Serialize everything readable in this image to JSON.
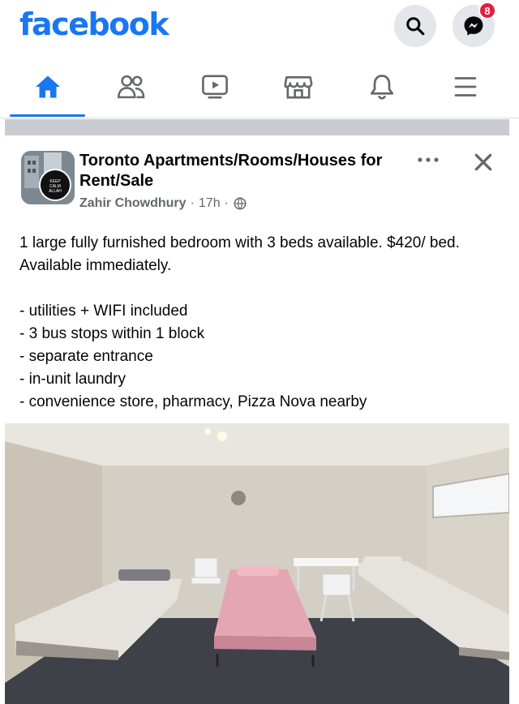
{
  "header": {
    "logo": "facebook",
    "search_icon": "search-icon",
    "messenger_icon": "messenger-icon",
    "messenger_badge": "8",
    "brand_color": "#1877f2"
  },
  "nav": {
    "items": [
      {
        "icon": "home-icon",
        "active": true
      },
      {
        "icon": "friends-icon",
        "active": false
      },
      {
        "icon": "watch-icon",
        "active": false
      },
      {
        "icon": "marketplace-icon",
        "active": false
      },
      {
        "icon": "notifications-icon",
        "active": false
      },
      {
        "icon": "menu-icon",
        "active": false
      }
    ]
  },
  "post": {
    "group_name": "Toronto Apartments/Rooms/Houses for Rent/Sale",
    "author": "Zahir Chowdhury",
    "time": "17h",
    "separator": "·",
    "privacy_icon": "globe-icon",
    "more_icon": "more-icon",
    "close_icon": "close-icon",
    "body_line1": "1 large fully furnished bedroom with 3 beds available. $420/ bed. Available immediately.",
    "bullets": [
      "- utilities + WIFI included",
      "- 3 bus stops within 1 block",
      "- separate entrance",
      "- in-unit laundry",
      "- convenience store, pharmacy, Pizza Nova nearby"
    ],
    "photo_subject": "bedroom-photo"
  }
}
